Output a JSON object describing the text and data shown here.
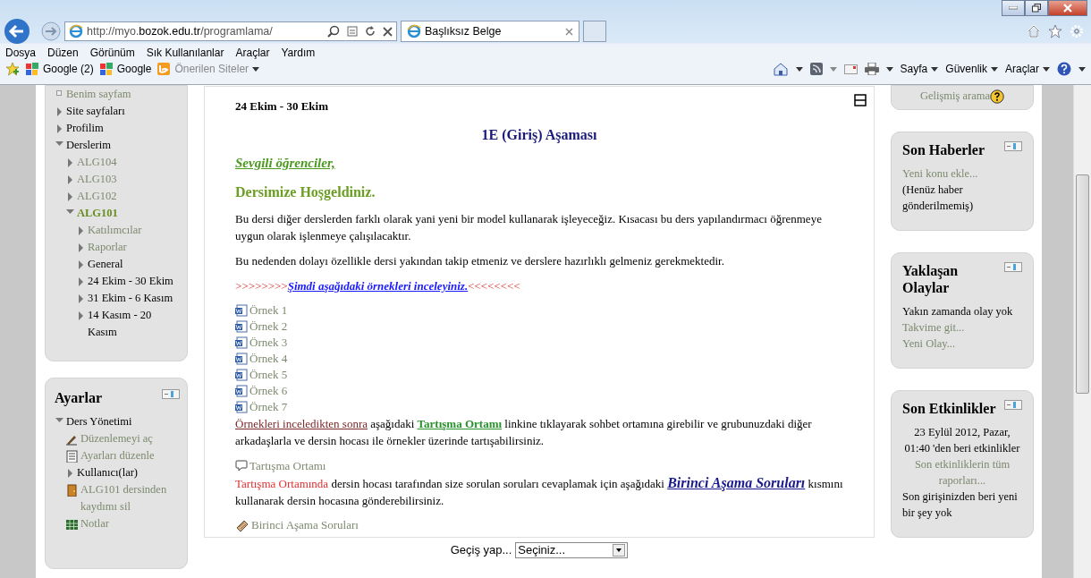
{
  "browser": {
    "address": "http://myo.**bozok.edu.tr**/programlama/",
    "tab_title": "Başlıksız Belge",
    "menu": [
      "Dosya",
      "Düzen",
      "Görünüm",
      "Sık Kullanılanlar",
      "Araçlar",
      "Yardım"
    ],
    "favorites": [
      {
        "label": "Google (2)",
        "kind": "google"
      },
      {
        "label": "Google",
        "kind": "google"
      },
      {
        "label": "Önerilen Siteler",
        "kind": "suggested"
      }
    ],
    "commands": [
      "Sayfa",
      "Güvenlik",
      "Araçlar"
    ]
  },
  "navigation": {
    "items": [
      {
        "label": "Benim sayfam",
        "kind": "link"
      },
      {
        "label": "Site sayfaları",
        "kind": "plain",
        "expanded": false
      },
      {
        "label": "Profilim",
        "kind": "plain",
        "expanded": false
      },
      {
        "label": "Derslerim",
        "kind": "plain",
        "expanded": true,
        "children": [
          {
            "label": "ALG104",
            "kind": "link",
            "expanded": false
          },
          {
            "label": "ALG103",
            "kind": "link",
            "expanded": false
          },
          {
            "label": "ALG102",
            "kind": "link",
            "expanded": false
          },
          {
            "label": "ALG101",
            "kind": "current",
            "expanded": true,
            "children": [
              {
                "label": "Katılımcılar",
                "kind": "link",
                "expanded": false
              },
              {
                "label": "Raporlar",
                "kind": "link",
                "expanded": false
              },
              {
                "label": "General",
                "kind": "plain",
                "expanded": false
              },
              {
                "label": "24 Ekim - 30 Ekim",
                "kind": "plain",
                "expanded": false
              },
              {
                "label": "31 Ekim - 6 Kasım",
                "kind": "plain",
                "expanded": false
              },
              {
                "label": "14 Kasım - 20 Kasım",
                "kind": "plain",
                "expanded": false
              }
            ]
          }
        ]
      }
    ]
  },
  "settings": {
    "title": "Ayarlar",
    "items": [
      {
        "label": "Ders Yönetimi",
        "kind": "plain",
        "expanded": true,
        "children": [
          {
            "label": "Düzenlemeyi aç",
            "kind": "edit"
          },
          {
            "label": "Ayarları düzenle",
            "kind": "settings"
          },
          {
            "label": "Kullanıcı(lar)",
            "kind": "plain",
            "expanded": false
          },
          {
            "label": "ALG101 dersinden kaydımı sil",
            "kind": "unenrol"
          },
          {
            "label": "Notlar",
            "kind": "grades"
          }
        ]
      }
    ]
  },
  "section": {
    "date": "24 Ekim - 30 Ekim",
    "title": "1E (Giriş) Aşaması",
    "content": [
      {
        "kind": "greeting",
        "text": "Sevgili öğrenciler,"
      },
      {
        "kind": "subheading",
        "text": "Dersimize Hoşgeldiniz."
      },
      {
        "kind": "paragraph",
        "segments": [
          {
            "kind": "plain",
            "text": "Bu dersi diğer derslerden farklı olarak yani yeni bir model kullanarak işleyeceğiz. Kısacası bu ders yapılandırmacı öğrenmeye uygun olarak işlenmeye çalışılacaktır."
          }
        ]
      },
      {
        "kind": "paragraph",
        "segments": [
          {
            "kind": "plain",
            "text": "Bu nedenden dolayı özellikle dersi yakından takip etmeniz ve derslere hazırlıklı gelmeniz gerekmektedir."
          }
        ]
      },
      {
        "kind": "paragraph",
        "segments": [
          {
            "kind": "red",
            "text": ">>>>>>>>"
          },
          {
            "kind": "blue-link",
            "text": "Şimdi aşağıdaki örnekleri inceleyiniz."
          },
          {
            "kind": "red",
            "text": "<<<<<<<<"
          }
        ]
      },
      {
        "kind": "document",
        "text": "Örnek 1"
      },
      {
        "kind": "document",
        "text": "Örnek 2"
      },
      {
        "kind": "document",
        "text": "Örnek 3"
      },
      {
        "kind": "document",
        "text": "Örnek 4"
      },
      {
        "kind": "document",
        "text": "Örnek 5"
      },
      {
        "kind": "document",
        "text": "Örnek 6"
      },
      {
        "kind": "document",
        "text": "Örnek 7"
      },
      {
        "kind": "paragraph",
        "segments": [
          {
            "kind": "maroon-link",
            "text": "Örnekleri inceledikten sonra"
          },
          {
            "kind": "plain",
            "text": " aşağıdaki "
          },
          {
            "kind": "green-link",
            "text": "Tartışma Ortamı"
          },
          {
            "kind": "plain",
            "text": " linkine tıklayarak sohbet ortamına girebilir ve grubunuzdaki diğer arkadaşlarla ve dersin hocası ile örnekler üzerinde tartışabilirsiniz."
          }
        ]
      },
      {
        "kind": "forum",
        "text": "Tartışma Ortamı"
      },
      {
        "kind": "paragraph",
        "segments": [
          {
            "kind": "red",
            "text": "Tartışma Ortamında"
          },
          {
            "kind": "plain",
            "text": " dersin hocası tarafından size sorulan soruları cevaplamak için aşağıdaki "
          },
          {
            "kind": "navy-link",
            "text": "Birinci Aşama Soruları"
          },
          {
            "kind": "plain",
            "text": " kısmını kullanarak dersin hocasına gönderebilirsiniz."
          }
        ]
      },
      {
        "kind": "quiz",
        "text": "Birinci Aşama Soruları"
      }
    ]
  },
  "jump": {
    "label": "Geçiş yap...",
    "value": "Seçiniz..."
  },
  "blocks": [
    {
      "lines": [
        {
          "kind": "help-link",
          "text": "Gelişmiş arama"
        }
      ]
    },
    {
      "title": "Son Haberler",
      "lines": [
        {
          "kind": "link",
          "text": "Yeni konu ekle..."
        },
        {
          "kind": "plain",
          "text": "(Henüz haber gönderilmemiş)"
        }
      ]
    },
    {
      "title": "Yaklaşan Olaylar",
      "lines": [
        {
          "kind": "plain",
          "text": "Yakın zamanda olay yok"
        },
        {
          "kind": "link",
          "text": "Takvime git..."
        },
        {
          "kind": "link",
          "text": "Yeni Olay..."
        }
      ]
    },
    {
      "title": "Son Etkinlikler",
      "lines": [
        {
          "kind": "centered",
          "text": "23 Eylül 2012, Pazar, 01:40 'den beri etkinlikler"
        },
        {
          "kind": "centered-link",
          "text": "Son etkinliklerin tüm raporları..."
        },
        {
          "kind": "plain",
          "text": "Son girişinizden beri yeni bir şey yok"
        }
      ]
    }
  ]
}
